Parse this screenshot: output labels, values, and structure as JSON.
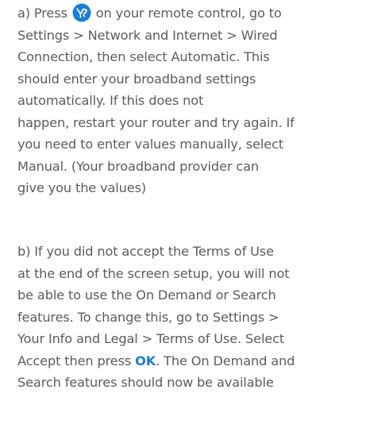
{
  "accent_color": "#1a7fd1",
  "icons": {
    "youview_button": "youview-button-icon"
  },
  "paragraph_a": {
    "prefix": "a) Press ",
    "line1_suffix": " on your remote control, go to",
    "lines": [
      "Settings > Network and Internet > Wired",
      "Connection, then select Automatic. This",
      "should enter your broadband settings",
      "automatically. If this does not",
      "happen, restart your router and try again.  If",
      "you need to enter values manually, select",
      "Manual. (Your broadband provider can",
      "give you the values)"
    ]
  },
  "paragraph_b": {
    "lines": [
      "b) If you did not accept the Terms of Use",
      "at the end of the screen setup, you will not",
      "be able to use the On Demand or Search",
      "features. To change this, go to Settings >",
      "Your Info and Legal > Terms of Use. Select"
    ],
    "accept_prefix": "Accept then press ",
    "ok_key": "OK",
    "accept_suffix": ". The On Demand and",
    "last_line": "Search features should now be available"
  }
}
